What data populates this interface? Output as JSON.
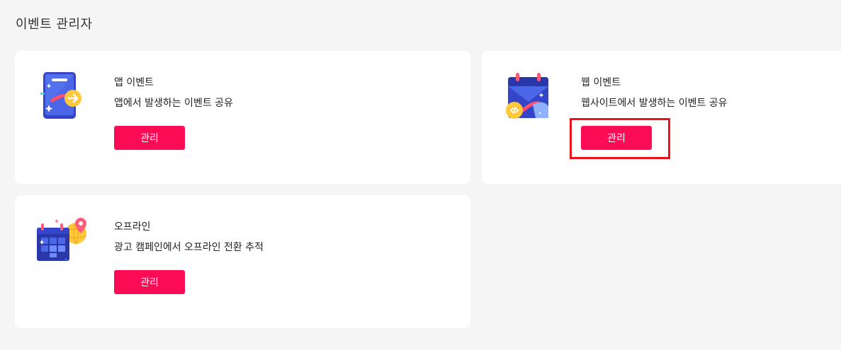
{
  "page": {
    "title": "이벤트 관리자"
  },
  "cards": {
    "app": {
      "title": "앱 이벤트",
      "description": "앱에서 발생하는 이벤트 공유",
      "button_label": "관리",
      "icon": "mobile-app-icon"
    },
    "web": {
      "title": "웹 이벤트",
      "description": "웹사이트에서 발생하는 이벤트 공유",
      "button_label": "관리",
      "icon": "web-calendar-code-icon"
    },
    "offline": {
      "title": "오프라인",
      "description": "광고 캠페인에서 오프라인 전환 추적",
      "button_label": "관리",
      "icon": "offline-calendar-globe-icon"
    }
  },
  "colors": {
    "accent": "#fd0c56",
    "highlight": "#e8131b",
    "background": "#f5f5f5",
    "card": "#ffffff"
  }
}
